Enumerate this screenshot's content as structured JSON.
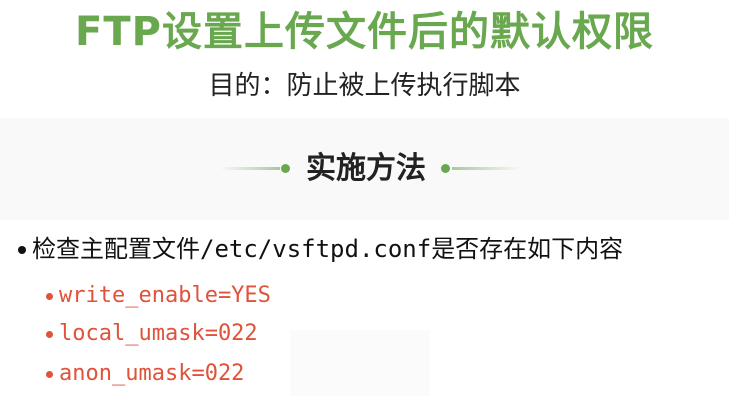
{
  "slide": {
    "title": "FTP设置上传文件后的默认权限",
    "subtitle": "目的：防止被上传执行脚本",
    "section_heading": "实施方法",
    "main_bullet": {
      "prefix": "检查主配置文件",
      "path": "/etc/vsftpd.conf",
      "suffix": "是否存在如下内容"
    },
    "config_items": [
      "write_enable=YES",
      "local_umask=022",
      "anon_umask=022"
    ]
  },
  "colors": {
    "title": "#6aa84f",
    "accent_dot": "#6aa84f",
    "config_text": "#e0523a",
    "body_text": "#111111"
  },
  "icons": {
    "bullet": "filled-circle",
    "section_divider": "dot-with-fading-line"
  }
}
